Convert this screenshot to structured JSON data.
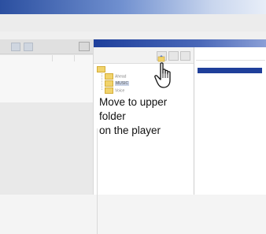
{
  "callout": {
    "text": "Move to upper folder\non the player"
  },
  "player_tree": {
    "items": [
      {
        "label": "Ahead"
      },
      {
        "label": "MUSIC"
      },
      {
        "label": "Voice"
      }
    ],
    "selected_index": 1
  },
  "colors": {
    "title_bar_dark": "#2b4fa0",
    "player_title": "#1e3f9b",
    "selection": "#1f3f9a",
    "folder": "#f1d36c"
  },
  "icons": [
    "hand-pointer-icon",
    "folder-icon",
    "up-folder-icon"
  ]
}
